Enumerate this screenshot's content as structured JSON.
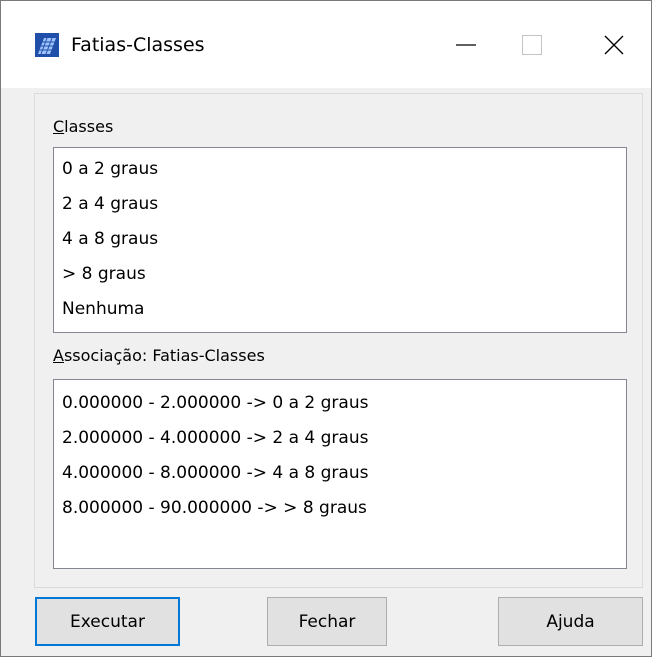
{
  "window": {
    "title": "Fatias-Classes",
    "controls": [
      "minimize",
      "maximize",
      "close"
    ]
  },
  "classes": {
    "label_accel": "C",
    "label_rest": "lasses",
    "items": [
      "0 a 2 graus",
      "2 a 4 graus",
      "4 a 8 graus",
      "> 8 graus",
      "Nenhuma"
    ]
  },
  "association": {
    "label_accel": "A",
    "label_rest": "ssociação: Fatias-Classes",
    "items": [
      "0.000000 - 2.000000 -> 0 a 2 graus",
      "2.000000 - 4.000000 -> 2 a 4 graus",
      "4.000000 - 8.000000 -> 4 a 8 graus",
      "8.000000 - 90.000000 -> > 8 graus"
    ]
  },
  "buttons": {
    "execute": "Executar",
    "close": "Fechar",
    "help": "Ajuda"
  },
  "colors": {
    "focus_border": "#0078d7",
    "icon_blue": "#1f4fa8"
  }
}
